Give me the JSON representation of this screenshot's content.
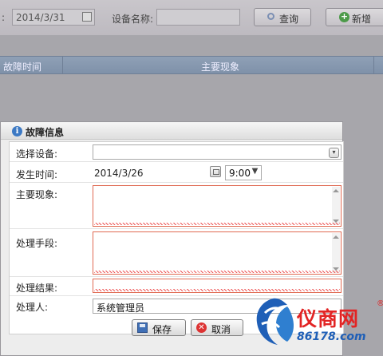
{
  "toolbar": {
    "colon": ":",
    "date_value": "2014/3/31",
    "device_name_label": "设备名称:",
    "device_name_value": "",
    "search_label": "查询",
    "add_label": "新增"
  },
  "grid": {
    "columns": [
      "故障时间",
      "主要现象"
    ]
  },
  "dialog": {
    "title": "故障信息",
    "fields": {
      "device": {
        "label": "选择设备:",
        "value": ""
      },
      "time": {
        "label": "发生时间:",
        "date": "2014/3/26",
        "hour": "9:00"
      },
      "symptom": {
        "label": "主要现象:",
        "value": ""
      },
      "method": {
        "label": "处理手段:",
        "value": ""
      },
      "result": {
        "label": "处理结果:",
        "value": ""
      },
      "handler": {
        "label": "处理人:",
        "value": "系统管理员"
      }
    },
    "save_label": "保存",
    "cancel_label": "取消"
  },
  "watermark": {
    "name": "仪商网",
    "registered": "®",
    "url": "86178.com"
  },
  "colors": {
    "error_border": "#e06a52",
    "grid_header": "#8fa0b6",
    "watermark_red": "#e22424",
    "watermark_blue": "#1f5fb7"
  }
}
